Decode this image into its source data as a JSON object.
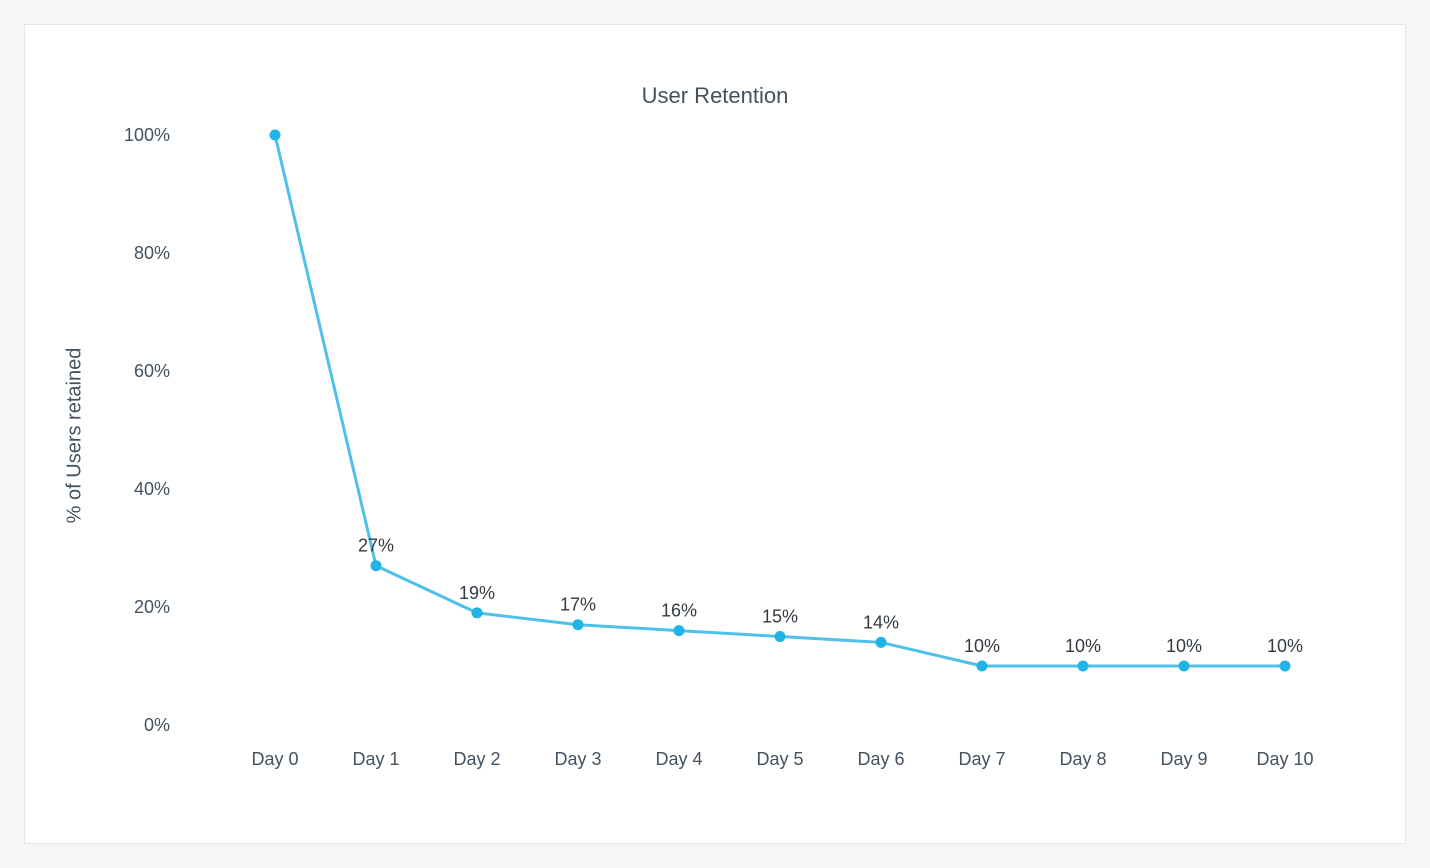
{
  "chart_data": {
    "type": "line",
    "title": "User Retention",
    "ylabel": "% of Users retained",
    "xlabel": "",
    "ylim": [
      0,
      100
    ],
    "categories": [
      "Day 0",
      "Day 1",
      "Day 2",
      "Day 3",
      "Day 4",
      "Day 5",
      "Day 6",
      "Day 7",
      "Day 8",
      "Day 9",
      "Day 10"
    ],
    "values": [
      100,
      27,
      19,
      17,
      16,
      15,
      14,
      10,
      10,
      10,
      10
    ],
    "data_labels": [
      "",
      "27%",
      "19%",
      "17%",
      "16%",
      "15%",
      "14%",
      "10%",
      "10%",
      "10%",
      "10%"
    ],
    "y_ticks": [
      0,
      20,
      40,
      60,
      80,
      100
    ],
    "y_tick_labels": [
      "0%",
      "20%",
      "40%",
      "60%",
      "80%",
      "100%"
    ],
    "colors": {
      "line": "#4ec0ea",
      "point": "#22b3e6",
      "axis": "#44525f"
    }
  }
}
